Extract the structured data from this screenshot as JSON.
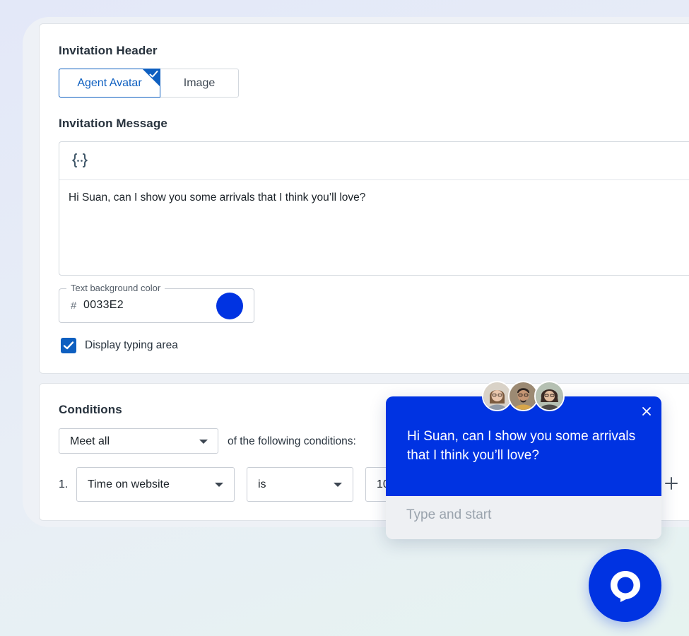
{
  "colors": {
    "accent": "#0e5fc0",
    "brand": "#0033E2",
    "chat_input_bg": "#eef0f3"
  },
  "invitation_header": {
    "title": "Invitation Header",
    "options": [
      {
        "label": "Agent Avatar",
        "selected": true
      },
      {
        "label": "Image",
        "selected": false
      }
    ]
  },
  "invitation_message": {
    "title": "Invitation Message",
    "toolbar_icon": "variable-braces-icon",
    "text": "Hi Suan, can I show you some arrivals that I think you’ll love?"
  },
  "text_background_color": {
    "label": "Text background color",
    "prefix": "#",
    "value": "0033E2",
    "swatch": "#0033E2"
  },
  "display_typing_area": {
    "label": "Display typing area",
    "checked": true
  },
  "conditions": {
    "title": "Conditions",
    "match_select": "Meet all",
    "suffix_text": "of the following conditions:",
    "rows": [
      {
        "index": "1.",
        "field": "Time on website",
        "operator": "is",
        "value": "10"
      }
    ]
  },
  "chat_preview": {
    "message": "Hi Suan, can I show you some arrivals that I think you’ll love?",
    "input_placeholder": "Type and start",
    "avatar_count": 3
  }
}
